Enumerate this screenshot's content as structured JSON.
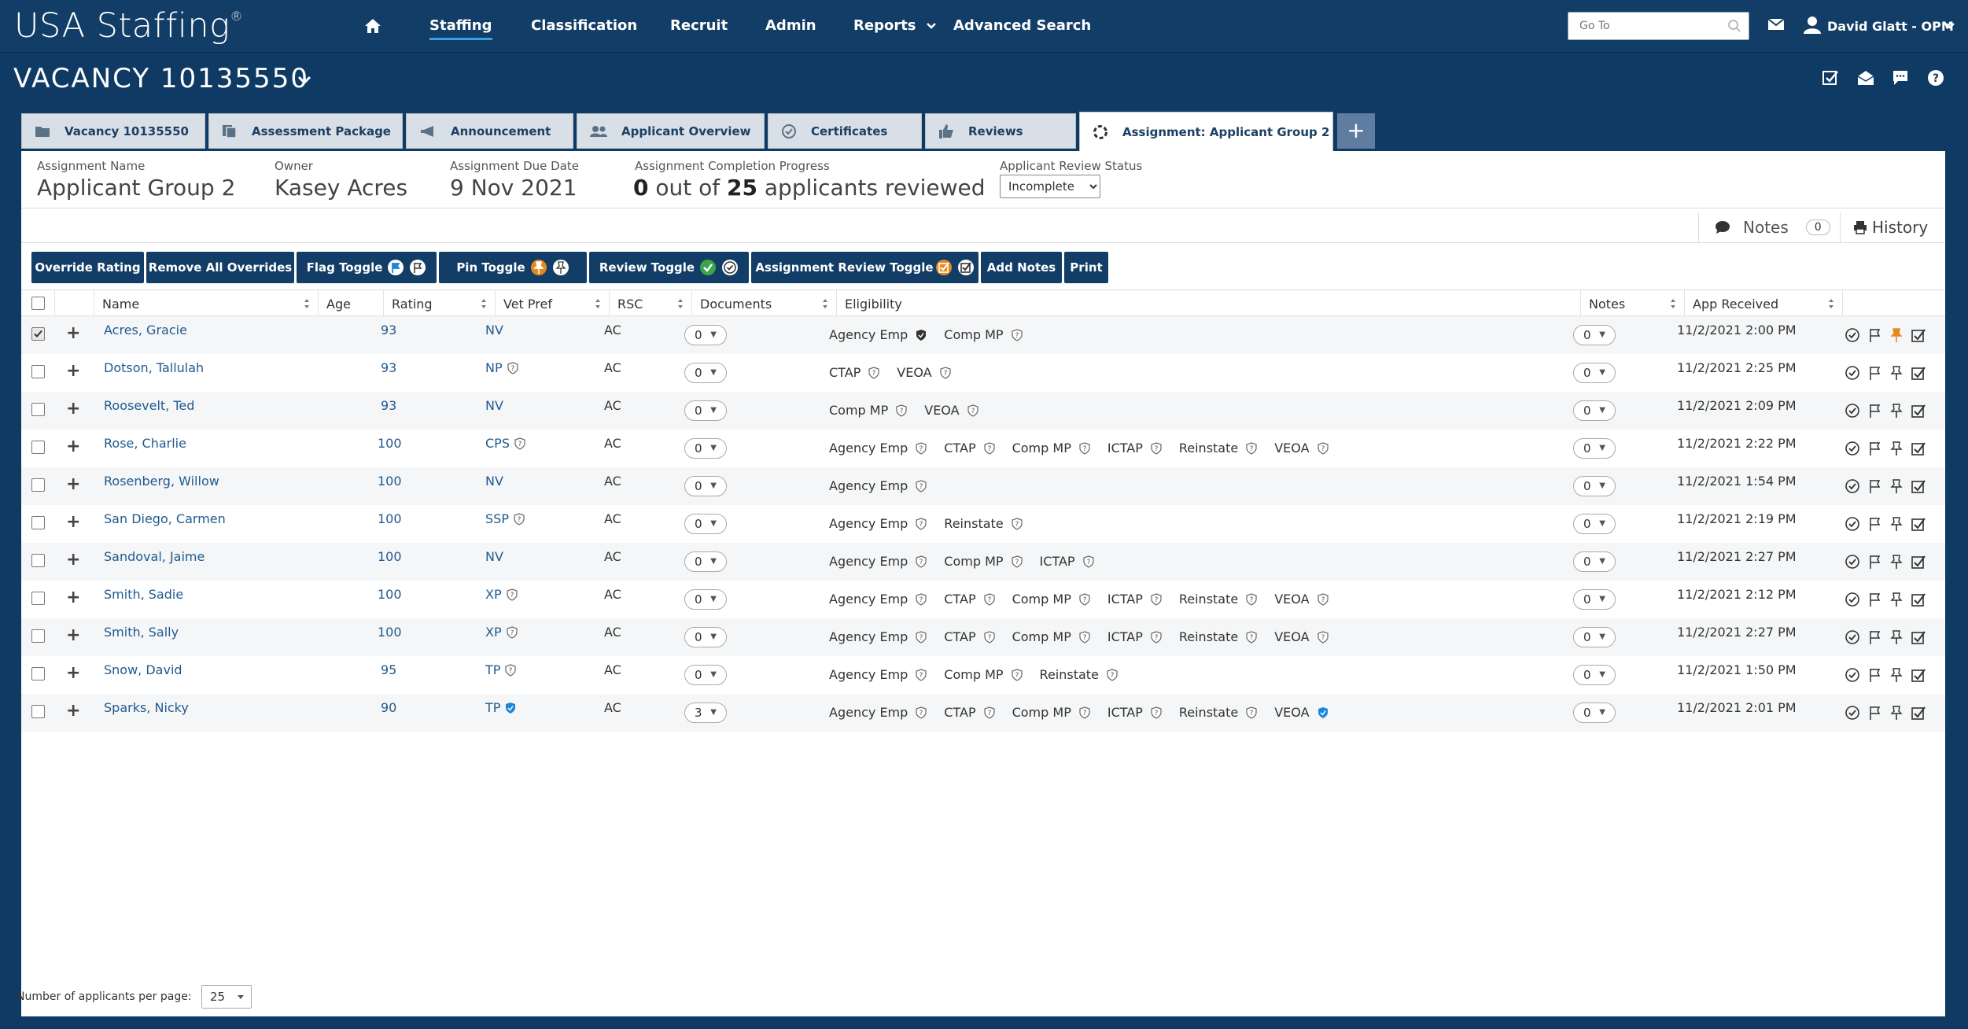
{
  "nav": {
    "logo": "USA Staffing",
    "logo_mark": "®",
    "items": [
      "Staffing",
      "Classification",
      "Recruit",
      "Admin",
      "Reports",
      "Advanced Search"
    ],
    "goto_placeholder": "Go To",
    "user": "David Glatt - OPM"
  },
  "vacancy": {
    "title": "VACANCY 10135550"
  },
  "tabs": [
    {
      "label": "Vacancy 10135550",
      "icon": "folder-icon"
    },
    {
      "label": "Assessment Package",
      "icon": "documents-icon"
    },
    {
      "label": "Announcement",
      "icon": "megaphone-icon"
    },
    {
      "label": "Applicant Overview",
      "icon": "people-icon"
    },
    {
      "label": "Certificates",
      "icon": "check-circle-icon"
    },
    {
      "label": "Reviews",
      "icon": "thumbs-up-icon"
    },
    {
      "label": "Assignment: Applicant Group 2",
      "icon": "spinner-icon"
    }
  ],
  "tab_add": "+",
  "summary": {
    "assignment_name_label": "Assignment Name",
    "assignment_name": "Applicant Group 2",
    "owner_label": "Owner",
    "owner": "Kasey Acres",
    "due_label": "Assignment Due Date",
    "due": "9 Nov 2021",
    "progress_label": "Assignment Completion Progress",
    "progress_done": "0",
    "progress_mid": " out of ",
    "progress_total": "25",
    "progress_tail": " applicants reviewed",
    "status_label": "Applicant Review Status",
    "status_value": "Incomplete"
  },
  "notes": {
    "label": "Notes",
    "count": "0"
  },
  "history": {
    "label": "History"
  },
  "toolbar": {
    "override": "Override Rating",
    "remove_overrides": "Remove All Overrides",
    "flag": "Flag Toggle",
    "pin": "Pin Toggle",
    "review": "Review Toggle",
    "assignment_review": "Assignment Review Toggle",
    "add_notes": "Add Notes",
    "print": "Print"
  },
  "columns": [
    "Name",
    "Age",
    "Rating",
    "Vet Pref",
    "RSC",
    "Documents",
    "Eligibility",
    "Notes",
    "App Received"
  ],
  "rows": [
    {
      "name": "Acres, Gracie",
      "rating": "93",
      "vet": "NV",
      "vet_q": false,
      "vet_verified": false,
      "rsc": "AC",
      "docs": "0",
      "notes": "0",
      "received": "11/2/2021 2:00 PM",
      "checked": true,
      "pinned": true,
      "elig": [
        {
          "label": "Agency Emp",
          "status": "verified-dark"
        },
        {
          "label": "Comp MP",
          "status": "question"
        }
      ]
    },
    {
      "name": "Dotson, Tallulah",
      "rating": "93",
      "vet": "NP",
      "vet_q": true,
      "vet_verified": false,
      "rsc": "AC",
      "docs": "0",
      "notes": "0",
      "received": "11/2/2021 2:25 PM",
      "checked": false,
      "pinned": false,
      "elig": [
        {
          "label": "CTAP",
          "status": "question"
        },
        {
          "label": "VEOA",
          "status": "question"
        }
      ]
    },
    {
      "name": "Roosevelt, Ted",
      "rating": "93",
      "vet": "NV",
      "vet_q": false,
      "vet_verified": false,
      "rsc": "AC",
      "docs": "0",
      "notes": "0",
      "received": "11/2/2021 2:09 PM",
      "checked": false,
      "pinned": false,
      "elig": [
        {
          "label": "Comp MP",
          "status": "question"
        },
        {
          "label": "VEOA",
          "status": "question"
        }
      ]
    },
    {
      "name": "Rose, Charlie",
      "rating": "100",
      "vet": "CPS",
      "vet_q": true,
      "vet_verified": false,
      "rsc": "AC",
      "docs": "0",
      "notes": "0",
      "received": "11/2/2021 2:22 PM",
      "checked": false,
      "pinned": false,
      "elig": [
        {
          "label": "Agency Emp",
          "status": "question"
        },
        {
          "label": "CTAP",
          "status": "question"
        },
        {
          "label": "Comp MP",
          "status": "question"
        },
        {
          "label": "ICTAP",
          "status": "question"
        },
        {
          "label": "Reinstate",
          "status": "question"
        },
        {
          "label": "VEOA",
          "status": "question"
        }
      ]
    },
    {
      "name": "Rosenberg, Willow",
      "rating": "100",
      "vet": "NV",
      "vet_q": false,
      "vet_verified": false,
      "rsc": "AC",
      "docs": "0",
      "notes": "0",
      "received": "11/2/2021 1:54 PM",
      "checked": false,
      "pinned": false,
      "elig": [
        {
          "label": "Agency Emp",
          "status": "question"
        }
      ]
    },
    {
      "name": "San Diego, Carmen",
      "rating": "100",
      "vet": "SSP",
      "vet_q": true,
      "vet_verified": false,
      "rsc": "AC",
      "docs": "0",
      "notes": "0",
      "received": "11/2/2021 2:19 PM",
      "checked": false,
      "pinned": false,
      "elig": [
        {
          "label": "Agency Emp",
          "status": "question"
        },
        {
          "label": "Reinstate",
          "status": "question"
        }
      ]
    },
    {
      "name": "Sandoval, Jaime",
      "rating": "100",
      "vet": "NV",
      "vet_q": false,
      "vet_verified": false,
      "rsc": "AC",
      "docs": "0",
      "notes": "0",
      "received": "11/2/2021 2:27 PM",
      "checked": false,
      "pinned": false,
      "elig": [
        {
          "label": "Agency Emp",
          "status": "question"
        },
        {
          "label": "Comp MP",
          "status": "question"
        },
        {
          "label": "ICTAP",
          "status": "question"
        }
      ]
    },
    {
      "name": "Smith, Sadie",
      "rating": "100",
      "vet": "XP",
      "vet_q": true,
      "vet_verified": false,
      "rsc": "AC",
      "docs": "0",
      "notes": "0",
      "received": "11/2/2021 2:12 PM",
      "checked": false,
      "pinned": false,
      "elig": [
        {
          "label": "Agency Emp",
          "status": "question"
        },
        {
          "label": "CTAP",
          "status": "question"
        },
        {
          "label": "Comp MP",
          "status": "question"
        },
        {
          "label": "ICTAP",
          "status": "question"
        },
        {
          "label": "Reinstate",
          "status": "question"
        },
        {
          "label": "VEOA",
          "status": "question"
        }
      ]
    },
    {
      "name": "Smith, Sally",
      "rating": "100",
      "vet": "XP",
      "vet_q": true,
      "vet_verified": false,
      "rsc": "AC",
      "docs": "0",
      "notes": "0",
      "received": "11/2/2021 2:27 PM",
      "checked": false,
      "pinned": false,
      "elig": [
        {
          "label": "Agency Emp",
          "status": "question"
        },
        {
          "label": "CTAP",
          "status": "question"
        },
        {
          "label": "Comp MP",
          "status": "question"
        },
        {
          "label": "ICTAP",
          "status": "question"
        },
        {
          "label": "Reinstate",
          "status": "question"
        },
        {
          "label": "VEOA",
          "status": "question"
        }
      ]
    },
    {
      "name": "Snow, David",
      "rating": "95",
      "vet": "TP",
      "vet_q": true,
      "vet_verified": false,
      "rsc": "AC",
      "docs": "0",
      "notes": "0",
      "received": "11/2/2021 1:50 PM",
      "checked": false,
      "pinned": false,
      "elig": [
        {
          "label": "Agency Emp",
          "status": "question"
        },
        {
          "label": "Comp MP",
          "status": "question"
        },
        {
          "label": "Reinstate",
          "status": "question"
        }
      ]
    },
    {
      "name": "Sparks, Nicky",
      "rating": "90",
      "vet": "TP",
      "vet_q": false,
      "vet_verified": true,
      "rsc": "AC",
      "docs": "3",
      "notes": "0",
      "received": "11/2/2021 2:01 PM",
      "checked": false,
      "pinned": false,
      "elig": [
        {
          "label": "Agency Emp",
          "status": "question"
        },
        {
          "label": "CTAP",
          "status": "question"
        },
        {
          "label": "Comp MP",
          "status": "question"
        },
        {
          "label": "ICTAP",
          "status": "question"
        },
        {
          "label": "Reinstate",
          "status": "question"
        },
        {
          "label": "VEOA",
          "status": "verified-blue"
        }
      ]
    }
  ],
  "footer": {
    "per_page_label": "Number of applicants per page:",
    "per_page": "25"
  },
  "colors": {
    "navy": "#123d66",
    "tab": "#d9dfe6",
    "link": "#1f5a8f",
    "pin_orange": "#e58a1f",
    "check_green": "#3aa64a",
    "verified_blue": "#1e88d8"
  }
}
